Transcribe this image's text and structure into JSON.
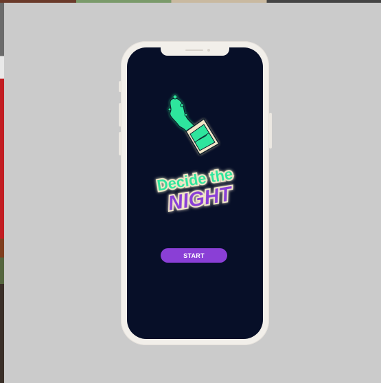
{
  "app": {
    "logo": {
      "line1": "Decide the",
      "line2": "NIGHT",
      "icon": "spilling-cup-icon"
    },
    "start_button": {
      "label": "START"
    }
  },
  "colors": {
    "page_background": "#cbcbcb",
    "phone_frame": "#f2efea",
    "screen_background": "#070f28",
    "accent_green": "#2ee59d",
    "accent_purple": "#8a3fd6",
    "button_text": "#ffffff"
  }
}
